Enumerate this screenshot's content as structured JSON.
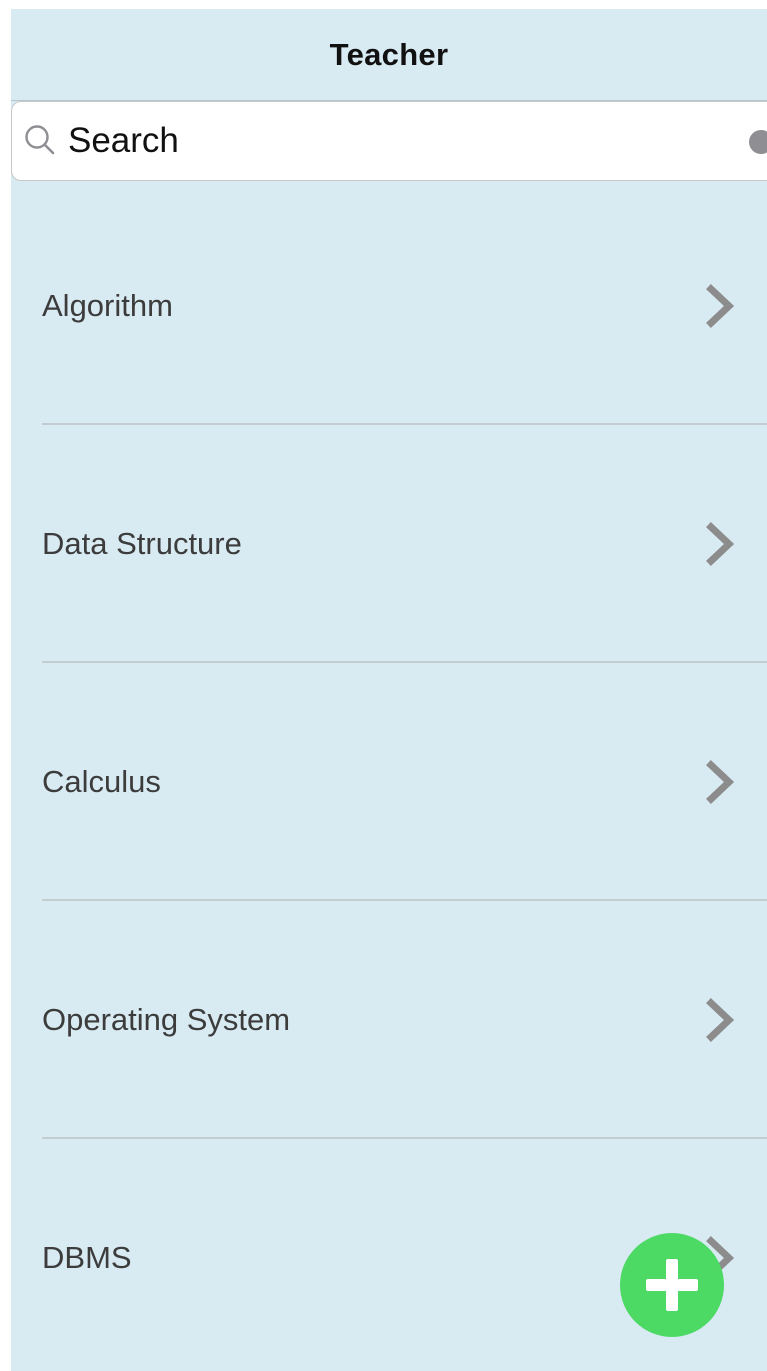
{
  "nav": {
    "title": "Teacher"
  },
  "search": {
    "placeholder": "Search",
    "icon": "search-icon",
    "clear_icon": "clear-icon"
  },
  "courses": [
    {
      "label": "Algorithm",
      "icon": "chevron-right-icon"
    },
    {
      "label": "Data Structure",
      "icon": "chevron-right-icon"
    },
    {
      "label": "Calculus",
      "icon": "chevron-right-icon"
    },
    {
      "label": "Operating System",
      "icon": "chevron-right-icon"
    },
    {
      "label": "DBMS",
      "icon": "chevron-right-icon"
    }
  ],
  "fab": {
    "icon": "plus-icon"
  },
  "colors": {
    "background": "#d8eaf2",
    "fab": "#4cd964",
    "chevron": "#8c8c8c",
    "separator": "#c2ccd1"
  }
}
